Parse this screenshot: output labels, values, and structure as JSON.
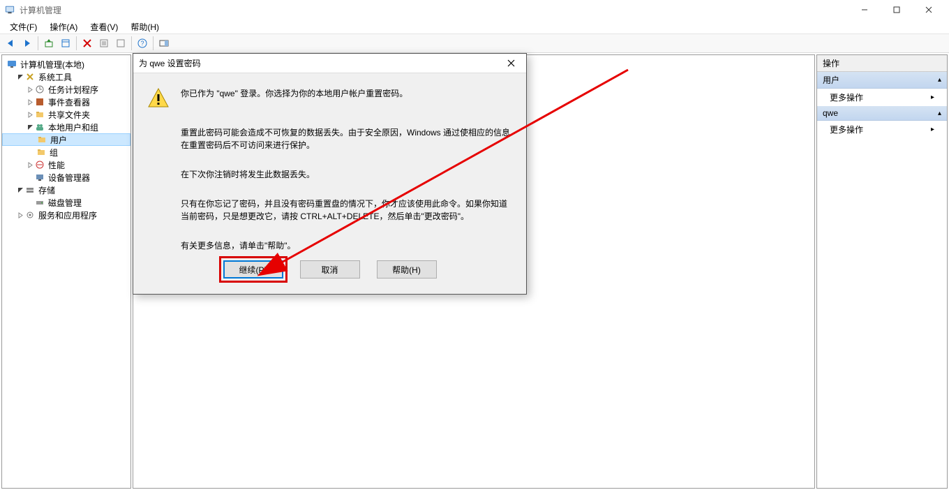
{
  "window": {
    "title": "计算机管理",
    "controls": {
      "min": "min",
      "max": "max",
      "close": "close"
    }
  },
  "menubar": {
    "file": "文件(F)",
    "action": "操作(A)",
    "view": "查看(V)",
    "help": "帮助(H)"
  },
  "tree": {
    "root": "计算机管理(本地)",
    "system_tools": "系统工具",
    "task_scheduler": "任务计划程序",
    "event_viewer": "事件查看器",
    "shared_folders": "共享文件夹",
    "local_users": "本地用户和组",
    "users": "用户",
    "groups": "组",
    "performance": "性能",
    "device_manager": "设备管理器",
    "storage": "存储",
    "disk_management": "磁盘管理",
    "services_apps": "服务和应用程序"
  },
  "right_panel": {
    "title": "操作",
    "section1": "用户",
    "more1": "更多操作",
    "section2": "qwe",
    "more2": "更多操作"
  },
  "dialog": {
    "title": "为 qwe 设置密码",
    "line1": "你已作为 \"qwe\" 登录。你选择为你的本地用户帐户重置密码。",
    "line2": "重置此密码可能会造成不可恢复的数据丢失。由于安全原因，Windows 通过使相应的信息在重置密码后不可访问来进行保护。",
    "line3": "在下次你注销时将发生此数据丢失。",
    "line4": "只有在你忘记了密码，并且没有密码重置盘的情况下，你才应该使用此命令。如果你知道当前密码，只是想更改它，请按 CTRL+ALT+DELETE，然后单击\"更改密码\"。",
    "line5": "有关更多信息，请单击\"帮助\"。",
    "btn_continue": "继续(P)",
    "btn_cancel": "取消",
    "btn_help": "帮助(H)"
  }
}
